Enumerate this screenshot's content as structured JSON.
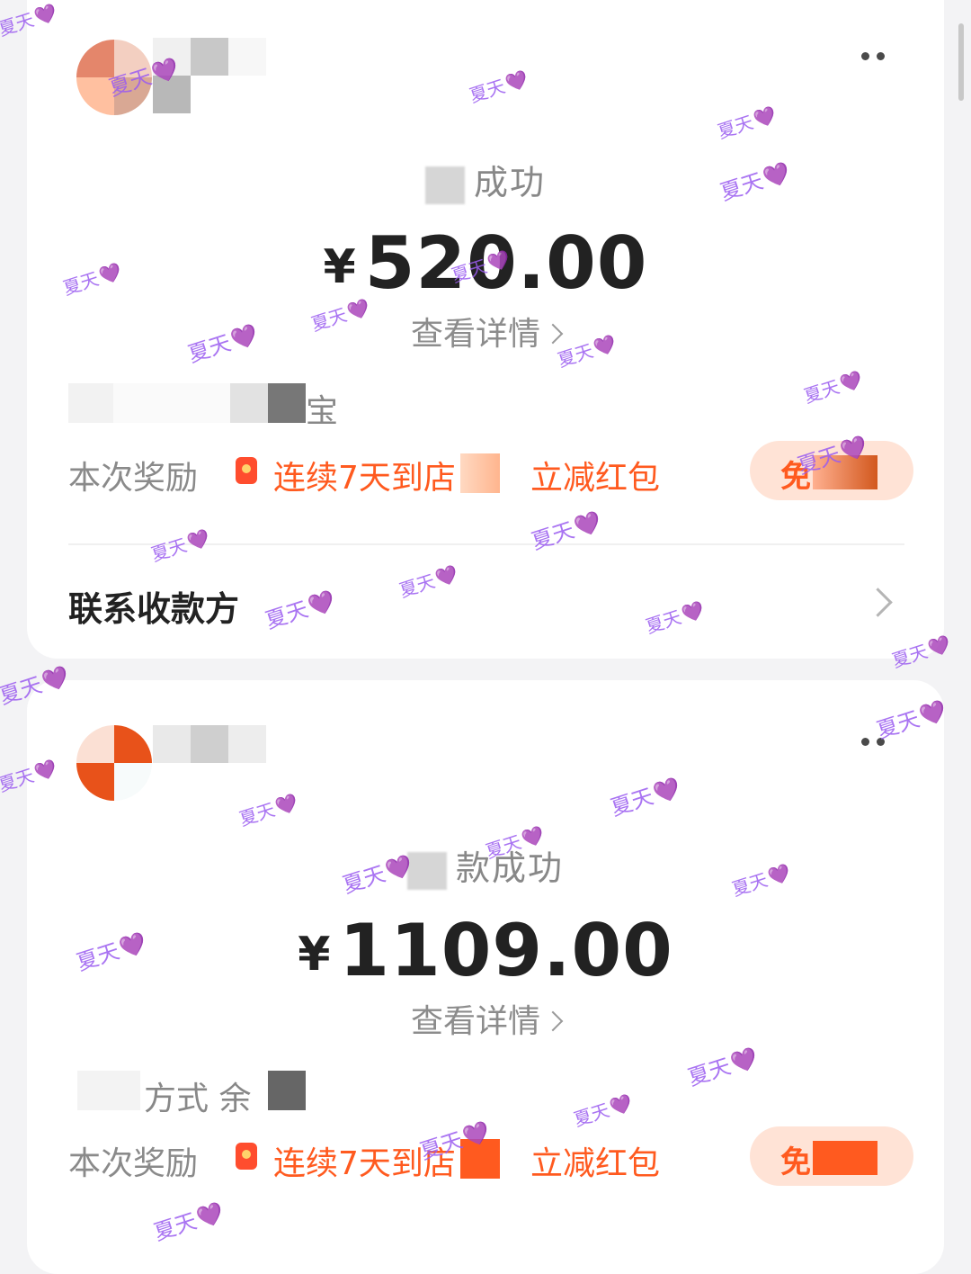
{
  "cards": [
    {
      "status_suffix": "成功",
      "currency": "¥",
      "amount": "520.00",
      "detail_link": "查看详情",
      "info_visible": "宝",
      "reward_label": "本次奖励",
      "reward_text_1": "连续7天到店",
      "reward_text_2": "立减红包",
      "claim_text": "免",
      "contact_label": "联系收款方"
    },
    {
      "status_suffix": "款成功",
      "currency": "¥",
      "amount": "1109.00",
      "detail_link": "查看详情",
      "info_visible": "方式 余",
      "reward_label": "本次奖励",
      "reward_text_1": "连续7天到店",
      "reward_text_2": "立减红包",
      "claim_text": "免"
    }
  ],
  "watermark": {
    "text": "夏天",
    "heart": "💜"
  }
}
